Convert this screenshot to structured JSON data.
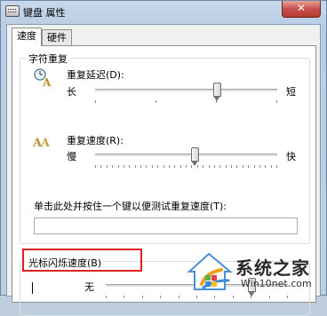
{
  "window": {
    "title": "键盘 属性",
    "close_glyph": "✕"
  },
  "tabs": [
    {
      "label": "速度",
      "active": true
    },
    {
      "label": "硬件",
      "active": false
    }
  ],
  "char_repeat": {
    "group_title": "字符重复",
    "delay": {
      "label": "重复延迟(D):",
      "left": "长",
      "right": "短",
      "value_fraction": 0.67
    },
    "rate": {
      "label": "重复速度(R):",
      "left": "慢",
      "right": "快",
      "value_fraction": 0.55
    },
    "test_label": "单击此处并按住一个键以便测试重复速度(T):",
    "test_value": ""
  },
  "cursor_blink": {
    "group_title": "光标闪烁速度(B)",
    "left": "无",
    "value_fraction": 0.8
  },
  "watermark": {
    "title": "系统之家",
    "url": "Win10net.com"
  },
  "colors": {
    "highlight_box": "#e02020",
    "title_bar": "#c9d9ec",
    "close_button": "#c75050"
  }
}
